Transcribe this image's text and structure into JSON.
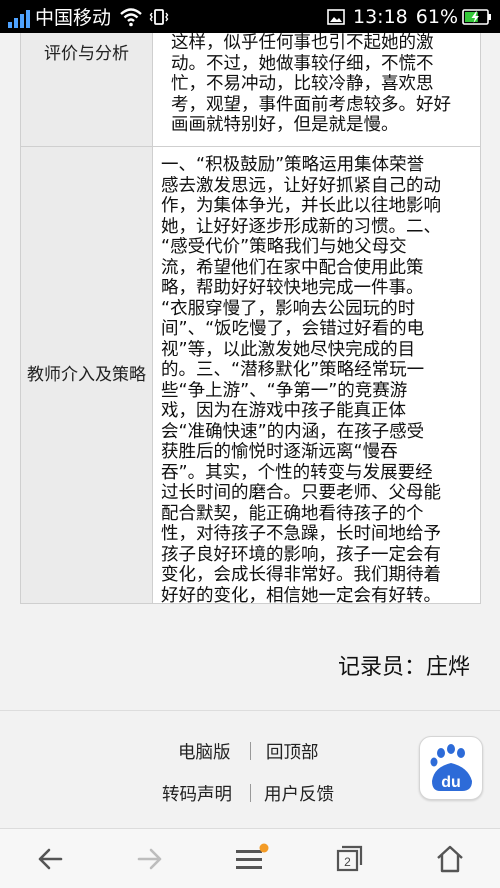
{
  "status_bar": {
    "carrier": "中国移动",
    "time": "13:18",
    "battery_percent": "61%",
    "signal_level": 4,
    "battery_level": 0.61,
    "icons": [
      "signal-icon",
      "wifi-icon",
      "vibrate-icon",
      "image-notification-icon",
      "battery-charging-icon"
    ]
  },
  "table": {
    "rows": [
      {
        "label": "评价与分析",
        "lines": [
          "这样，似乎任何事也引不起她的激",
          "动。不过，她做事较仔细，不慌不",
          "忙，不易冲动，比较冷静，喜欢思",
          "考，观望，事件面前考虑较多。好好",
          "画画就特别好，但是就是慢。"
        ]
      },
      {
        "label": "教师介入及策略",
        "lines": [
          "一、“积极鼓励”策略运用集体荣誉",
          "感去激发思远，让好好抓紧自己的动",
          "作，为集体争光，并长此以往地影响",
          "她，让好好逐步形成新的习惯。二、",
          "“感受代价”策略我们与她父母交",
          "流，希望他们在家中配合使用此策",
          "略，帮助好好较快地完成一件事。",
          "“衣服穿慢了，影响去公园玩的时",
          "间”、“饭吃慢了，会错过好看的电",
          "视”等，以此激发她尽快完成的目",
          "的。三、“潜移默化”策略经常玩一",
          "些“争上游”、“争第一”的竞赛游",
          "戏，因为在游戏中孩子能真正体",
          "会“准确快速”的内涵，在孩子感受",
          "获胜后的愉悦时逐渐远离“慢吞",
          "吞”。其实，个性的转变与发展要经",
          "过长时间的磨合。只要老师、父母能",
          "配合默契，能正确地看待孩子的个",
          "性，对待孩子不急躁，长时间地给予",
          "孩子良好环境的影响，孩子一定会有",
          "变化，会成长得非常好。我们期待着",
          "好好的变化，相信她一定会有好转。"
        ]
      }
    ]
  },
  "recorder": "记录员：庄烨",
  "footer": {
    "desktop_version": "电脑版",
    "back_to_top": "回顶部",
    "transcode_statement": "转码声明",
    "user_feedback": "用户反馈",
    "baidu_logo_text": "du"
  },
  "nav": {
    "tab_count": "2",
    "icons": [
      "back-arrow-icon",
      "forward-arrow-icon",
      "menu-icon",
      "tabs-icon",
      "home-icon"
    ],
    "menu_badge_color": "#f39b26"
  },
  "colors": {
    "signal_blue": "#4fa3ff",
    "battery_green": "#35c93a",
    "baidu_blue": "#2d6bd8"
  }
}
